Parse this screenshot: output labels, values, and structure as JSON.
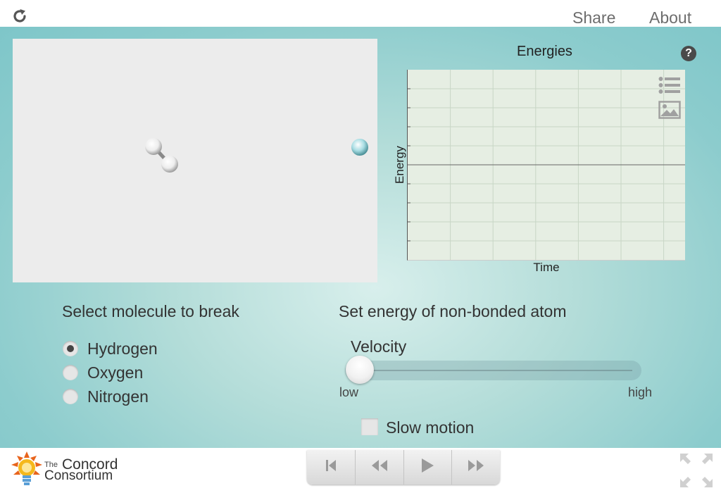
{
  "header": {
    "share_label": "Share",
    "about_label": "About"
  },
  "simulation": {
    "molecule": {
      "type": "diatomic",
      "atom_color": "#f4f4f4"
    },
    "free_atom": {
      "color": "#a8dde3"
    }
  },
  "graph": {
    "title": "Energies",
    "help_label": "?",
    "y_axis_label": "Energy",
    "x_axis_label": "Time",
    "tools": [
      "list-icon",
      "image-icon"
    ]
  },
  "molecule_select": {
    "title": "Select molecule to break",
    "options": [
      {
        "label": "Hydrogen",
        "selected": true
      },
      {
        "label": "Oxygen",
        "selected": false
      },
      {
        "label": "Nitrogen",
        "selected": false
      }
    ]
  },
  "energy_control": {
    "title": "Set energy of non-bonded atom",
    "slider_label": "Velocity",
    "min_label": "low",
    "max_label": "high",
    "value_fraction": 0.0
  },
  "slow_motion": {
    "label": "Slow motion",
    "checked": false
  },
  "footer": {
    "logo": {
      "the": "The",
      "concord": "Concord",
      "consortium": "Consortium"
    },
    "playback": [
      "reset-to-start-icon",
      "step-back-icon",
      "play-icon",
      "step-forward-icon"
    ]
  },
  "colors": {
    "accent_bg": "#8ccccd",
    "plot_bg": "#e6eee3"
  }
}
